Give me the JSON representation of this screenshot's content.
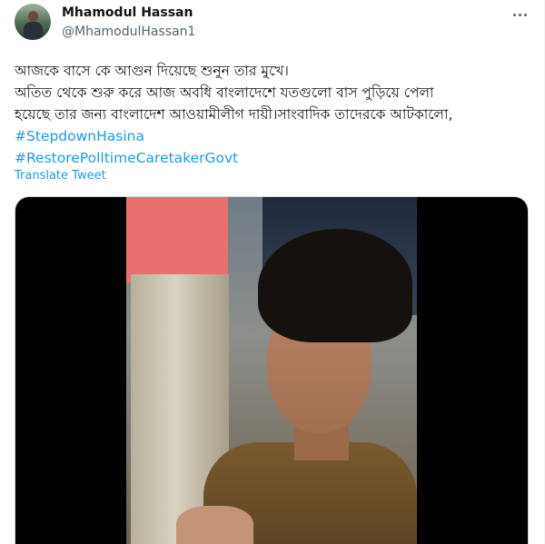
{
  "tweet": {
    "author": {
      "display_name": "Mhamodul Hassan",
      "handle": "@MhamodulHassan1"
    },
    "text_lines": [
      "আজকে বাসে কে আগুন দিয়েছে শুনুন তার মুখে।",
      "অতিত থেকে শুরু করে আজ অবধি বাংলাদেশে যতগুলো বাস পুড়িয়ে পেলা",
      "হয়েছে তার জন্য বাংলাদেশ আওয়ামীলীগ দায়ী।সাংবাদিক তাদেরকে আটকালো,"
    ],
    "hashtags": [
      "#StepdownHasina",
      "#RestorePolltimeCaretakerGovt"
    ],
    "translate_label": "Translate Tweet",
    "more_icon": "more-horizontal-icon"
  },
  "colors": {
    "link": "#1d9bf0",
    "text": "#0f1419",
    "secondary": "#536471"
  }
}
